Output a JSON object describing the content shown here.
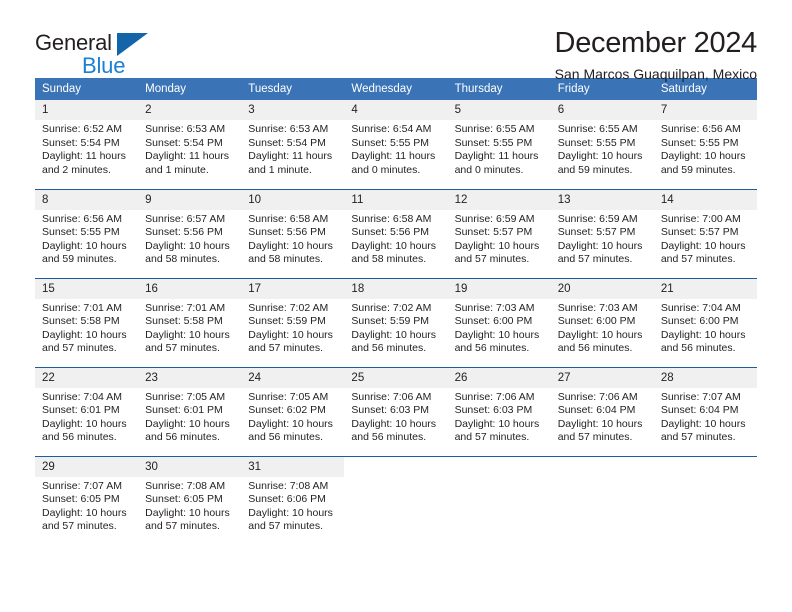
{
  "brand": {
    "line1": "General",
    "line2": "Blue",
    "triangle_color": "#1464aa",
    "blue_text_color": "#1b7fd4"
  },
  "header": {
    "title": "December 2024",
    "subtitle": "San Marcos Guaquilpan, Mexico"
  },
  "theme": {
    "header_bg": "#3b74b6",
    "row_divider": "#1f5c9e",
    "daynum_bg": "#f0f0f0",
    "text": "#231f20"
  },
  "weekday_headers": [
    "Sunday",
    "Monday",
    "Tuesday",
    "Wednesday",
    "Thursday",
    "Friday",
    "Saturday"
  ],
  "weeks": [
    [
      {
        "day": "1",
        "sunrise": "Sunrise: 6:52 AM",
        "sunset": "Sunset: 5:54 PM",
        "daylight1": "Daylight: 11 hours",
        "daylight2": "and 2 minutes."
      },
      {
        "day": "2",
        "sunrise": "Sunrise: 6:53 AM",
        "sunset": "Sunset: 5:54 PM",
        "daylight1": "Daylight: 11 hours",
        "daylight2": "and 1 minute."
      },
      {
        "day": "3",
        "sunrise": "Sunrise: 6:53 AM",
        "sunset": "Sunset: 5:54 PM",
        "daylight1": "Daylight: 11 hours",
        "daylight2": "and 1 minute."
      },
      {
        "day": "4",
        "sunrise": "Sunrise: 6:54 AM",
        "sunset": "Sunset: 5:55 PM",
        "daylight1": "Daylight: 11 hours",
        "daylight2": "and 0 minutes."
      },
      {
        "day": "5",
        "sunrise": "Sunrise: 6:55 AM",
        "sunset": "Sunset: 5:55 PM",
        "daylight1": "Daylight: 11 hours",
        "daylight2": "and 0 minutes."
      },
      {
        "day": "6",
        "sunrise": "Sunrise: 6:55 AM",
        "sunset": "Sunset: 5:55 PM",
        "daylight1": "Daylight: 10 hours",
        "daylight2": "and 59 minutes."
      },
      {
        "day": "7",
        "sunrise": "Sunrise: 6:56 AM",
        "sunset": "Sunset: 5:55 PM",
        "daylight1": "Daylight: 10 hours",
        "daylight2": "and 59 minutes."
      }
    ],
    [
      {
        "day": "8",
        "sunrise": "Sunrise: 6:56 AM",
        "sunset": "Sunset: 5:55 PM",
        "daylight1": "Daylight: 10 hours",
        "daylight2": "and 59 minutes."
      },
      {
        "day": "9",
        "sunrise": "Sunrise: 6:57 AM",
        "sunset": "Sunset: 5:56 PM",
        "daylight1": "Daylight: 10 hours",
        "daylight2": "and 58 minutes."
      },
      {
        "day": "10",
        "sunrise": "Sunrise: 6:58 AM",
        "sunset": "Sunset: 5:56 PM",
        "daylight1": "Daylight: 10 hours",
        "daylight2": "and 58 minutes."
      },
      {
        "day": "11",
        "sunrise": "Sunrise: 6:58 AM",
        "sunset": "Sunset: 5:56 PM",
        "daylight1": "Daylight: 10 hours",
        "daylight2": "and 58 minutes."
      },
      {
        "day": "12",
        "sunrise": "Sunrise: 6:59 AM",
        "sunset": "Sunset: 5:57 PM",
        "daylight1": "Daylight: 10 hours",
        "daylight2": "and 57 minutes."
      },
      {
        "day": "13",
        "sunrise": "Sunrise: 6:59 AM",
        "sunset": "Sunset: 5:57 PM",
        "daylight1": "Daylight: 10 hours",
        "daylight2": "and 57 minutes."
      },
      {
        "day": "14",
        "sunrise": "Sunrise: 7:00 AM",
        "sunset": "Sunset: 5:57 PM",
        "daylight1": "Daylight: 10 hours",
        "daylight2": "and 57 minutes."
      }
    ],
    [
      {
        "day": "15",
        "sunrise": "Sunrise: 7:01 AM",
        "sunset": "Sunset: 5:58 PM",
        "daylight1": "Daylight: 10 hours",
        "daylight2": "and 57 minutes."
      },
      {
        "day": "16",
        "sunrise": "Sunrise: 7:01 AM",
        "sunset": "Sunset: 5:58 PM",
        "daylight1": "Daylight: 10 hours",
        "daylight2": "and 57 minutes."
      },
      {
        "day": "17",
        "sunrise": "Sunrise: 7:02 AM",
        "sunset": "Sunset: 5:59 PM",
        "daylight1": "Daylight: 10 hours",
        "daylight2": "and 57 minutes."
      },
      {
        "day": "18",
        "sunrise": "Sunrise: 7:02 AM",
        "sunset": "Sunset: 5:59 PM",
        "daylight1": "Daylight: 10 hours",
        "daylight2": "and 56 minutes."
      },
      {
        "day": "19",
        "sunrise": "Sunrise: 7:03 AM",
        "sunset": "Sunset: 6:00 PM",
        "daylight1": "Daylight: 10 hours",
        "daylight2": "and 56 minutes."
      },
      {
        "day": "20",
        "sunrise": "Sunrise: 7:03 AM",
        "sunset": "Sunset: 6:00 PM",
        "daylight1": "Daylight: 10 hours",
        "daylight2": "and 56 minutes."
      },
      {
        "day": "21",
        "sunrise": "Sunrise: 7:04 AM",
        "sunset": "Sunset: 6:00 PM",
        "daylight1": "Daylight: 10 hours",
        "daylight2": "and 56 minutes."
      }
    ],
    [
      {
        "day": "22",
        "sunrise": "Sunrise: 7:04 AM",
        "sunset": "Sunset: 6:01 PM",
        "daylight1": "Daylight: 10 hours",
        "daylight2": "and 56 minutes."
      },
      {
        "day": "23",
        "sunrise": "Sunrise: 7:05 AM",
        "sunset": "Sunset: 6:01 PM",
        "daylight1": "Daylight: 10 hours",
        "daylight2": "and 56 minutes."
      },
      {
        "day": "24",
        "sunrise": "Sunrise: 7:05 AM",
        "sunset": "Sunset: 6:02 PM",
        "daylight1": "Daylight: 10 hours",
        "daylight2": "and 56 minutes."
      },
      {
        "day": "25",
        "sunrise": "Sunrise: 7:06 AM",
        "sunset": "Sunset: 6:03 PM",
        "daylight1": "Daylight: 10 hours",
        "daylight2": "and 56 minutes."
      },
      {
        "day": "26",
        "sunrise": "Sunrise: 7:06 AM",
        "sunset": "Sunset: 6:03 PM",
        "daylight1": "Daylight: 10 hours",
        "daylight2": "and 57 minutes."
      },
      {
        "day": "27",
        "sunrise": "Sunrise: 7:06 AM",
        "sunset": "Sunset: 6:04 PM",
        "daylight1": "Daylight: 10 hours",
        "daylight2": "and 57 minutes."
      },
      {
        "day": "28",
        "sunrise": "Sunrise: 7:07 AM",
        "sunset": "Sunset: 6:04 PM",
        "daylight1": "Daylight: 10 hours",
        "daylight2": "and 57 minutes."
      }
    ],
    [
      {
        "day": "29",
        "sunrise": "Sunrise: 7:07 AM",
        "sunset": "Sunset: 6:05 PM",
        "daylight1": "Daylight: 10 hours",
        "daylight2": "and 57 minutes."
      },
      {
        "day": "30",
        "sunrise": "Sunrise: 7:08 AM",
        "sunset": "Sunset: 6:05 PM",
        "daylight1": "Daylight: 10 hours",
        "daylight2": "and 57 minutes."
      },
      {
        "day": "31",
        "sunrise": "Sunrise: 7:08 AM",
        "sunset": "Sunset: 6:06 PM",
        "daylight1": "Daylight: 10 hours",
        "daylight2": "and 57 minutes."
      },
      {
        "day": "",
        "sunrise": "",
        "sunset": "",
        "daylight1": "",
        "daylight2": ""
      },
      {
        "day": "",
        "sunrise": "",
        "sunset": "",
        "daylight1": "",
        "daylight2": ""
      },
      {
        "day": "",
        "sunrise": "",
        "sunset": "",
        "daylight1": "",
        "daylight2": ""
      },
      {
        "day": "",
        "sunrise": "",
        "sunset": "",
        "daylight1": "",
        "daylight2": ""
      }
    ]
  ]
}
